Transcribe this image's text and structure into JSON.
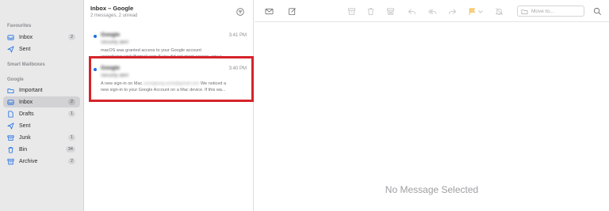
{
  "sidebar": {
    "favourites_title": "Favourites",
    "smart_title": "Smart Mailboxes",
    "google_title": "Google",
    "favourites": [
      {
        "label": "Inbox",
        "badge": "2",
        "icon": "inbox-icon"
      },
      {
        "label": "Sent",
        "badge": "",
        "icon": "sent-icon"
      }
    ],
    "google": [
      {
        "label": "Important",
        "badge": "",
        "icon": "folder-icon"
      },
      {
        "label": "Inbox",
        "badge": "2",
        "icon": "inbox-icon"
      },
      {
        "label": "Drafts",
        "badge": "1",
        "icon": "drafts-icon"
      },
      {
        "label": "Sent",
        "badge": "",
        "icon": "sent-icon"
      },
      {
        "label": "Junk",
        "badge": "1",
        "icon": "junk-icon"
      },
      {
        "label": "Bin",
        "badge": "34",
        "icon": "bin-icon"
      },
      {
        "label": "Archive",
        "badge": "2",
        "icon": "archive-icon"
      }
    ]
  },
  "list": {
    "title": "Inbox – Google",
    "subtitle": "2 messages, 2 unread",
    "messages": [
      {
        "sender": "Google",
        "time": "3:41 PM",
        "subject": "Security alert",
        "preview_line1": "macOS was granted access to your Google account",
        "preview_line2": "yoongkang.work@gmail.com If you did not grant access, you s..."
      },
      {
        "sender": "Google",
        "time": "3:40 PM",
        "subject": "Security alert",
        "preview_line1_a": "A new sign-in on Mac",
        "preview_line1_b": "yoongkang.work@gmail.com",
        "preview_line1_c": "We noticed a",
        "preview_line2": "new sign-in to your Google Account on a Mac device. If this wa..."
      }
    ]
  },
  "toolbar": {
    "moveto_placeholder": "Move to...",
    "icons": [
      "compose-window-icon",
      "new-message-icon",
      "archive-icon",
      "trash-icon",
      "junk-icon",
      "reply-icon",
      "reply-all-icon",
      "forward-icon",
      "flag-icon",
      "mute-icon",
      "folder-icon",
      "search-icon"
    ],
    "flag_color": "#f5b642"
  },
  "content": {
    "empty_text": "No Message Selected"
  },
  "colors": {
    "unread_dot": "#1f6de4",
    "highlight": "#d6232a"
  }
}
